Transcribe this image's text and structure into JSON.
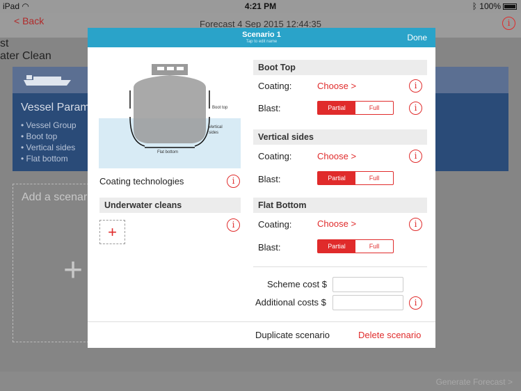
{
  "status": {
    "device": "iPad",
    "time": "4:21 PM",
    "battery": "100%"
  },
  "nav": {
    "back": "Back",
    "title": "Forecast 4 Sep 2015 12:44:35"
  },
  "background": {
    "vessel_title": "Vessel Param",
    "vessel_items": [
      "Vessel Group",
      "Boot top",
      "Vertical sides",
      "Flat bottom"
    ],
    "right_lines": [
      "st",
      "ater Clean"
    ],
    "add_scenario": "Add a scenar",
    "generate": "Generate Forecast"
  },
  "modal": {
    "title": "Scenario 1",
    "subtitle": "Tap to edit name",
    "done": "Done",
    "diagram": {
      "boot_top": "Boot top",
      "vertical_sides_1": "Vertical",
      "vertical_sides_2": "sides",
      "flat_bottom": "Flat bottom"
    },
    "coating_technologies": "Coating technologies",
    "underwater_cleans": "Underwater cleans",
    "add_symbol": "+",
    "sections": [
      {
        "title": "Boot Top",
        "coating_label": "Coating:",
        "choose": "Choose",
        "blast_label": "Blast:",
        "partial": "Partial",
        "full": "Full"
      },
      {
        "title": "Vertical sides",
        "coating_label": "Coating:",
        "choose": "Choose",
        "blast_label": "Blast:",
        "partial": "Partial",
        "full": "Full"
      },
      {
        "title": "Flat Bottom",
        "coating_label": "Coating:",
        "choose": "Choose",
        "blast_label": "Blast:",
        "partial": "Partial",
        "full": "Full"
      }
    ],
    "scheme_cost": "Scheme cost $",
    "additional_costs": "Additional costs $",
    "duplicate": "Duplicate scenario",
    "delete": "Delete scenario"
  },
  "colors": {
    "accent": "#e02b2b",
    "header": "#2aa3c9",
    "card": "#2a4b78"
  },
  "icons": {
    "info": "info-icon",
    "chevron": "chevron-right-icon",
    "wifi": "wifi-icon",
    "bluetooth": "bluetooth-icon"
  }
}
